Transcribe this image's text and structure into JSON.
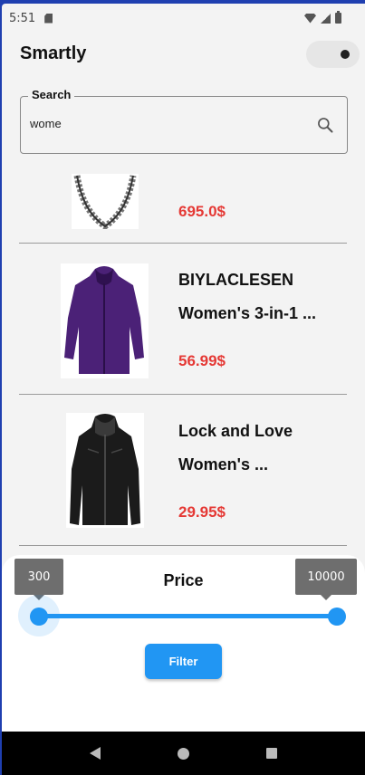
{
  "status_bar": {
    "time": "5:51"
  },
  "app": {
    "title": "Smartly"
  },
  "search": {
    "label": "Search",
    "value": "wome"
  },
  "products": [
    {
      "title_line1": "",
      "title_line2": "",
      "price": "695.0$",
      "image": "chain-necklace"
    },
    {
      "title_line1": "BIYLACLESEN",
      "title_line2": "Women's 3-in-1 ...",
      "price": "56.99$",
      "image": "purple-jacket"
    },
    {
      "title_line1": "Lock and Love",
      "title_line2": "Women's ...",
      "price": "29.95$",
      "image": "black-leather-jacket"
    }
  ],
  "filter_sheet": {
    "title": "Price",
    "min_label": "300",
    "max_label": "10000",
    "button_label": "Filter"
  },
  "colors": {
    "accent": "#2196f3",
    "price": "#e53935"
  }
}
